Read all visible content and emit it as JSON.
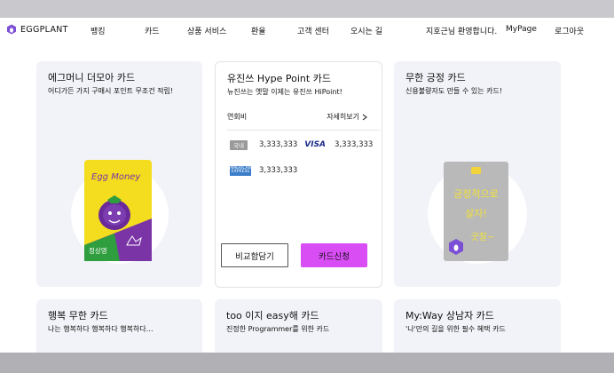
{
  "header": {
    "logo_text": "EGGPLANT",
    "nav": [
      "뱅킹",
      "카드",
      "상품 서비스",
      "환율",
      "고객 센터",
      "오시는 길"
    ],
    "greeting": "지호근님 환영합니다.",
    "mypage": "MyPage",
    "logout": "로그아웃"
  },
  "cards": [
    {
      "title": "에그머니 더모아 카드",
      "subtitle": "어디가든 가지 구매시 포인트 무조건 적립!",
      "card_image_text": "Egg Money",
      "card_image_bottom": "정상영"
    },
    {
      "title": "유진쓰 Hype Point 카드",
      "subtitle": "뉴진쓰는 옛말 이제는 유진쓰 HiPoint!",
      "fee_label": "연회비",
      "detail_link": "자세히보기",
      "fees": [
        {
          "badge": "국내",
          "domestic": "3,333,333",
          "brand": "VISA",
          "brand_amount": "3,333,333"
        },
        {
          "badge": "AMERICAN EXPRESS",
          "domestic": "3,333,333"
        }
      ],
      "compare_button": "비교함담기",
      "apply_button": "카드신청"
    },
    {
      "title": "무한 긍정 카드",
      "subtitle": "신용불량자도 만들 수 있는 카드!",
      "card_image_text": "긍정적으로 살자! 굿잘~"
    },
    {
      "title": "행복 무한 카드",
      "subtitle": "나는 행복하다 행복하다 행복하다…"
    },
    {
      "title": "too 이지 easy해 카드",
      "subtitle": "진정한 Programmer를 위한 카드"
    },
    {
      "title": "My:Way 상남자 카드",
      "subtitle": "'나'만의 길을 위한 필수 혜택 카드"
    }
  ],
  "colors": {
    "accent": "#d94df5",
    "logo": "#7b4fd6",
    "card_bg": "#f2f3f8"
  }
}
